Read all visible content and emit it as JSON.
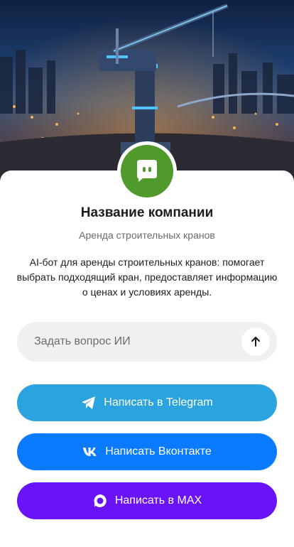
{
  "company": {
    "name": "Название компании",
    "subtitle": "Аренда строительных кранов",
    "description": "AI-бот для аренды строительных кранов: помогает выбрать подходящий кран, предоставляет информацию о ценах и условиях аренды."
  },
  "ask": {
    "placeholder": "Задать вопрос ИИ"
  },
  "buttons": {
    "telegram": "Написать в Telegram",
    "vk": "Написать Вконтакте",
    "max": "Написать в MAX"
  },
  "icons": {
    "avatar": "chat-bot-icon",
    "send": "arrow-up-icon",
    "telegram": "telegram-icon",
    "vk": "vk-icon",
    "max": "max-icon"
  },
  "colors": {
    "avatar_bg": "#4f9a2a",
    "telegram": "#2aa3df",
    "vk": "#0a7bff",
    "max": "#6b13f8"
  }
}
